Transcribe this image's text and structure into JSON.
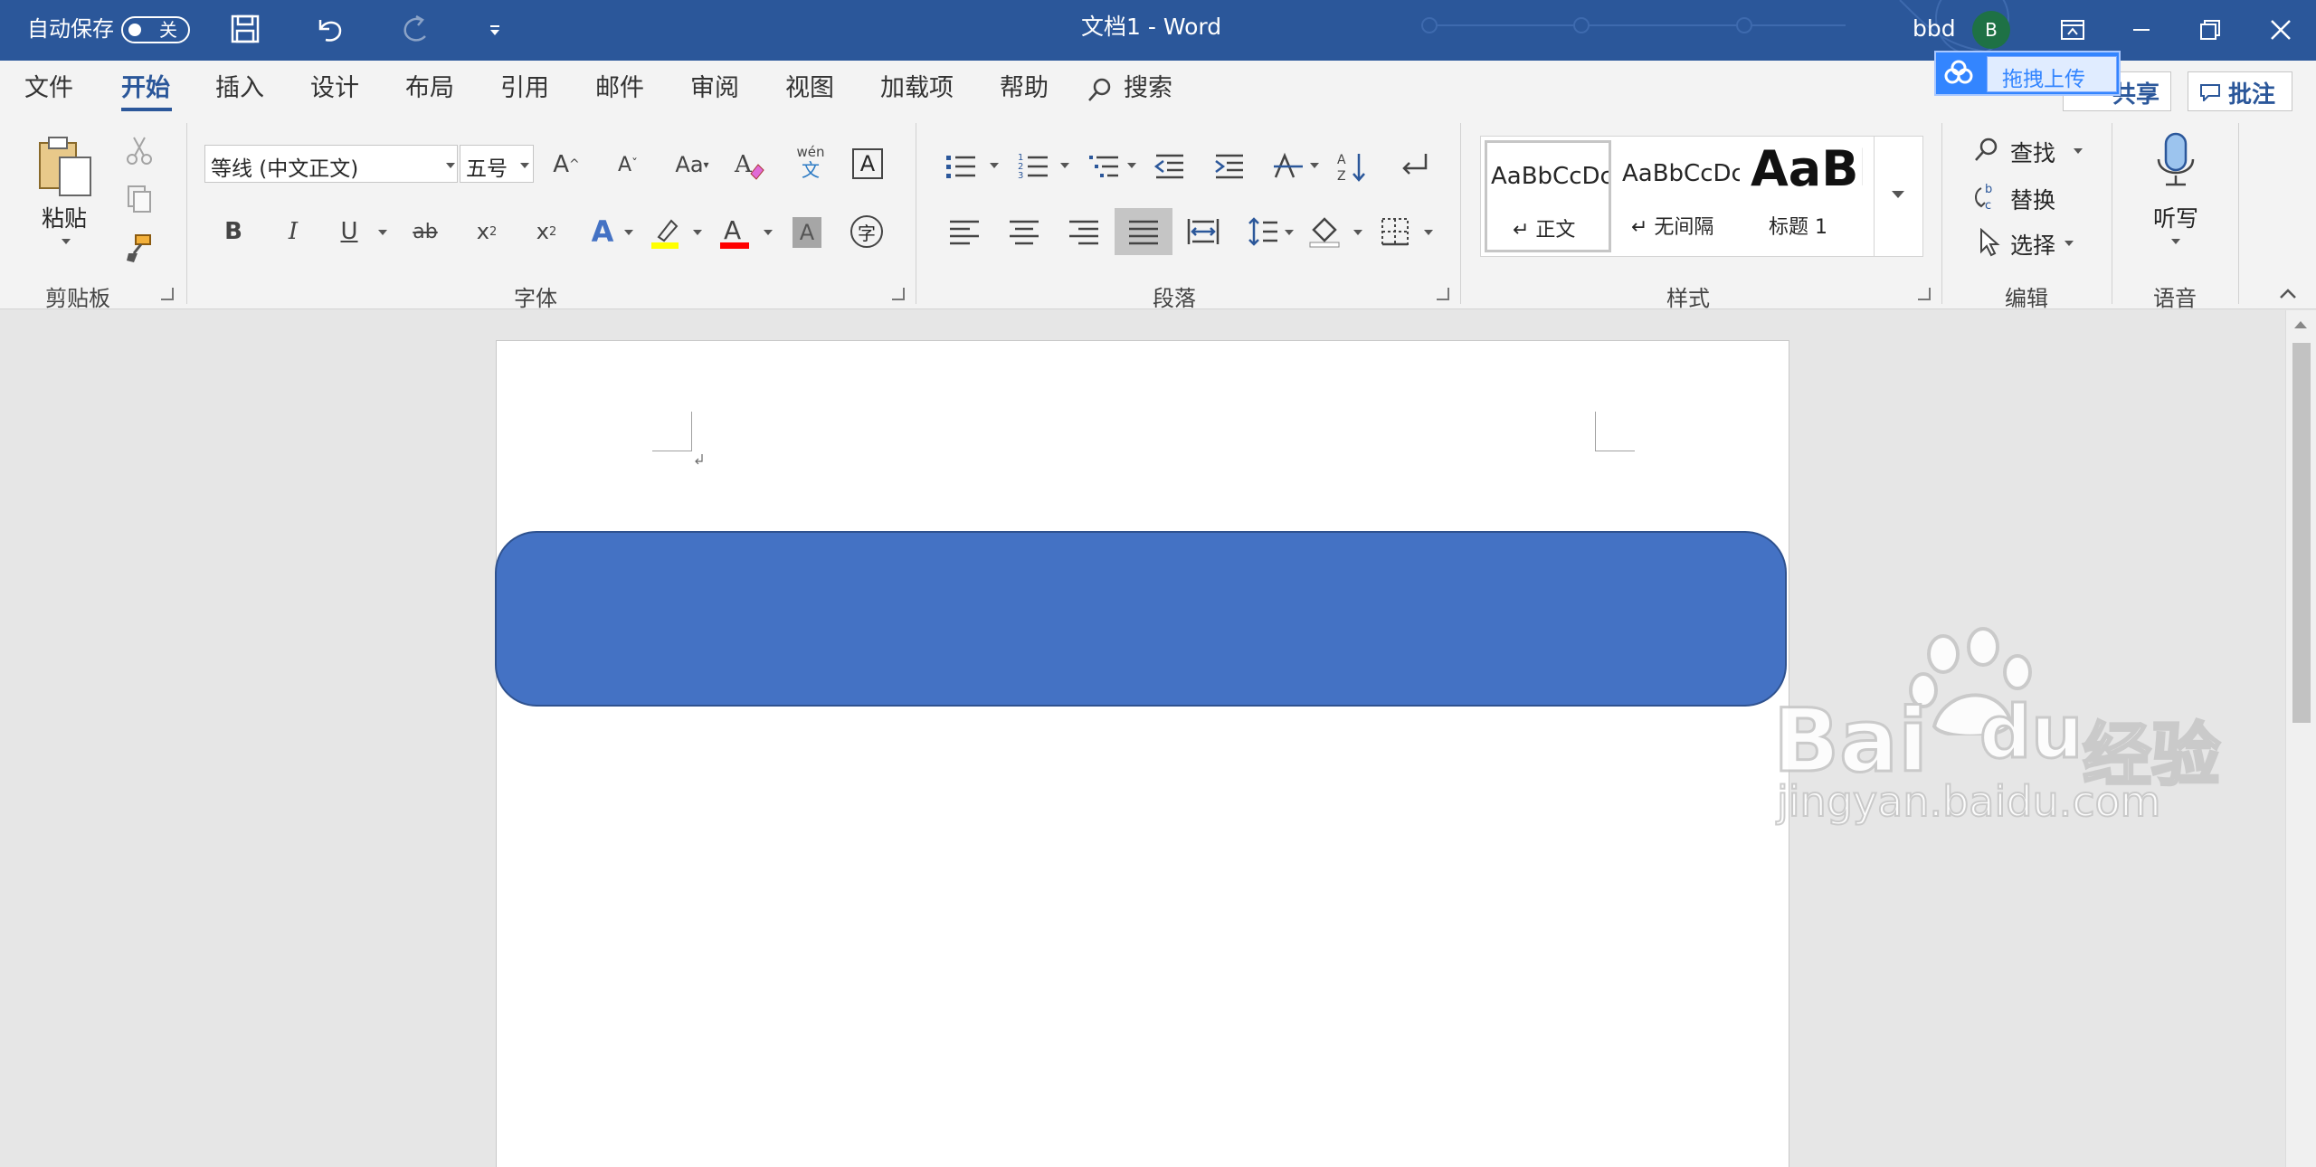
{
  "titlebar": {
    "autosave_label": "自动保存",
    "autosave_state": "关",
    "document_title": "文档1  -  Word",
    "user_name": "bbd",
    "avatar_initial": "B",
    "accent": "#2b579a",
    "avatar_color": "#1e7145"
  },
  "menu": {
    "tabs": [
      "文件",
      "开始",
      "插入",
      "设计",
      "布局",
      "引用",
      "邮件",
      "审阅",
      "视图",
      "加载项",
      "帮助"
    ],
    "active_tab": "开始",
    "search_label": "搜索",
    "share_label": "共享",
    "comment_label": "批注",
    "baidu_upload_label": "拖拽上传"
  },
  "ribbon": {
    "clipboard": {
      "paste_label": "粘贴",
      "group_label": "剪贴板"
    },
    "font": {
      "font_name": "等线 (中文正文)",
      "font_size": "五号",
      "group_label": "字体",
      "phonetic_top": "wén",
      "phonetic_bottom": "文",
      "char_border": "A",
      "enclose": "字",
      "highlight_color": "#ffff00",
      "font_color": "#ff0000"
    },
    "paragraph": {
      "group_label": "段落"
    },
    "styles": {
      "items": [
        {
          "preview": "AaBbCcDc",
          "name": "↵ 正文"
        },
        {
          "preview": "AaBbCcDc",
          "name": "↵ 无间隔"
        },
        {
          "preview": "AaBl",
          "name": "标题 1"
        }
      ],
      "group_label": "样式"
    },
    "editing": {
      "find_label": "查找",
      "replace_label": "替换",
      "select_label": "选择",
      "group_label": "编辑"
    },
    "voice": {
      "dictate_label": "听写",
      "group_label": "语音"
    }
  },
  "document": {
    "shape_color": "#4472c4",
    "shape_border": "#2f528f"
  },
  "watermark": {
    "brand": "Bai",
    "brand2": "du",
    "suffix": "经验",
    "url": "jingyan.baidu.com"
  }
}
